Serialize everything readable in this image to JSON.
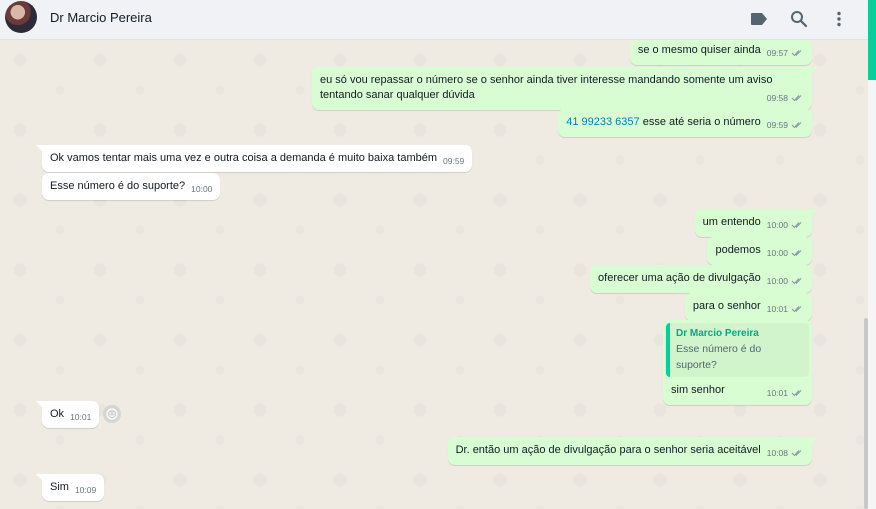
{
  "header": {
    "contact_name": "Dr Marcio Pereira",
    "icons": [
      "label-icon",
      "search-icon",
      "menu-icon"
    ]
  },
  "messages": [
    {
      "dir": "out",
      "text": "se o mesmo quiser ainda",
      "time": "09:57"
    },
    {
      "dir": "out",
      "text": "eu só vou repassar o número se o senhor ainda tiver interesse mandando somente um aviso tentando sanar qualquer dúvida",
      "time": "09:58"
    },
    {
      "dir": "out",
      "link": "41 99233 6357",
      "text": " esse até seria o número",
      "time": "09:59"
    },
    {
      "dir": "in",
      "text": "Ok vamos tentar mais uma vez e outra coisa a demanda é muito baixa também",
      "time": "09:59"
    },
    {
      "dir": "in",
      "text": "Esse número é do suporte?",
      "time": "10:00"
    },
    {
      "dir": "out",
      "text": "um entendo",
      "time": "10:00"
    },
    {
      "dir": "out",
      "text": "podemos",
      "time": "10:00"
    },
    {
      "dir": "out",
      "text": "oferecer uma ação de divulgação",
      "time": "10:00"
    },
    {
      "dir": "out",
      "text": "para o senhor",
      "time": "10:01"
    },
    {
      "dir": "out",
      "quote_author": "Dr Marcio Pereira",
      "quote_text": "Esse número é do suporte?",
      "text": "sim senhor",
      "time": "10:01"
    },
    {
      "dir": "in",
      "text": "Ok",
      "time": "10:01"
    },
    {
      "dir": "out",
      "text": "Dr. então um ação de divulgação para o senhor seria aceitável",
      "time": "10:08"
    },
    {
      "dir": "in",
      "text": "Sim",
      "time": "10:09"
    }
  ],
  "colors": {
    "outgoing": "#d9fdd3",
    "incoming": "#ffffff",
    "background": "#efeae2",
    "accent": "#06cf9c"
  }
}
